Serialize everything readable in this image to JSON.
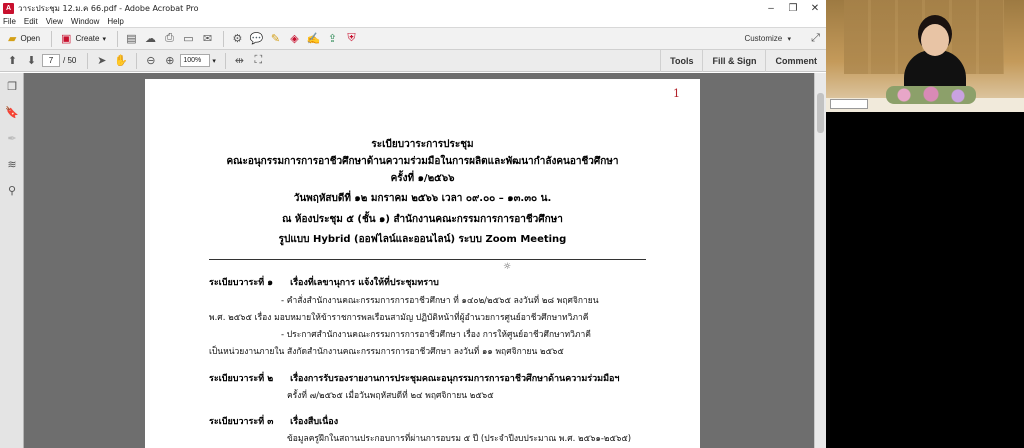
{
  "window": {
    "title": "วาระประชุม 12.ม.ค 66.pdf - Adobe Acrobat Pro",
    "controls": [
      "–",
      "❐",
      "✕"
    ]
  },
  "menu": [
    "File",
    "Edit",
    "View",
    "Window",
    "Help"
  ],
  "toolbar": {
    "open_label": "Open",
    "create_label": "Create",
    "customize_label": "Customize"
  },
  "nav": {
    "current_page": "7",
    "total_pages": "/ 50",
    "zoom": "100%"
  },
  "panes": {
    "tools": "Tools",
    "fill_sign": "Fill & Sign",
    "comment": "Comment"
  },
  "document": {
    "page_number": "1",
    "header": [
      "ระเบียบวาระการประชุม",
      "คณะอนุกรรมการการอาชีวศึกษาด้านความร่วมมือในการผลิตและพัฒนากำลังคนอาชีวศึกษา",
      "ครั้งที่ ๑/๒๕๖๖",
      "วันพฤหัสบดีที่ ๑๒ มกราคม ๒๕๖๖ เวลา ๐๙.๐๐ – ๑๓.๓๐ น.",
      "ณ ห้องประชุม ๕ (ชั้น ๑) สำนักงานคณะกรรมการการอาชีวศึกษา",
      "รูปแบบ Hybrid (ออฟไลน์และออนไลน์) ระบบ Zoom Meeting"
    ],
    "agenda": [
      {
        "label": "ระเบียบวาระที่ ๑",
        "title": "เรื่องที่เลขานุการ แจ้งให้ที่ประชุมทราบ",
        "lines": [
          "- คำสั่งสำนักงานคณะกรรมการการอาชีวศึกษา ที่ ๑๔๐๒/๒๕๖๕ ลงวันที่ ๒๘ พฤศจิกายน",
          "พ.ศ. ๒๕๖๕ เรื่อง มอบหมายให้ข้าราชการพลเรือนสามัญ ปฏิบัติหน้าที่ผู้อำนวยการศูนย์อาชีวศึกษาทวิภาคี",
          "- ประกาศสำนักงานคณะกรรมการการอาชีวศึกษา เรื่อง การให้ศูนย์อาชีวศึกษาทวิภาคี",
          "เป็นหน่วยงานภายใน สังกัดสำนักงานคณะกรรมการการอาชีวศึกษา ลงวันที่ ๑๑ พฤศจิกายน ๒๕๖๕"
        ]
      },
      {
        "label": "ระเบียบวาระที่ ๒",
        "title": "เรื่องการรับรองรายงานการประชุมคณะอนุกรรมการการอาชีวศึกษาด้านความร่วมมือฯ",
        "lines": [
          "ครั้งที่ ๗/๒๕๖๕ เมื่อวันพฤหัสบดีที่ ๒๔ พฤศจิกายน ๒๕๖๕"
        ]
      },
      {
        "label": "ระเบียบวาระที่ ๓",
        "title": "เรื่องสืบเนื่อง",
        "lines": [
          "ข้อมูลครูฝึกในสถานประกอบการที่ผ่านการอบรม ๕ ปี (ประจำปีงบประมาณ พ.ศ. ๒๕๖๑-๒๕๖๕)"
        ]
      }
    ]
  }
}
